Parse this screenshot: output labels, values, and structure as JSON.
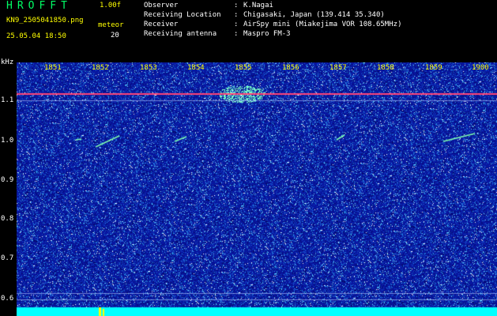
{
  "header": {
    "title": "HROFFT",
    "version": "1.00f",
    "filename": "KN9_2505041850.png",
    "meteor_label": "meteor",
    "datetime": "25.05.04 18:50",
    "meteor_count": "20"
  },
  "info": [
    {
      "label": "Observer",
      "sep": ":",
      "value": "K.Nagai"
    },
    {
      "label": "Receiving Location",
      "sep": ":",
      "value": "Chigasaki, Japan (139.414 35.340)"
    },
    {
      "label": "Receiver",
      "sep": ":",
      "value": "AirSpy mini (Miakejima VOR 108.65MHz)"
    },
    {
      "label": "Receiving antenna",
      "sep": ":",
      "value": "Maspro FM-3"
    }
  ],
  "axis": {
    "y_unit": "kHz",
    "y_ticks": [
      "1.1",
      "1.0",
      "0.9",
      "0.8",
      "0.7",
      "0.6"
    ],
    "y_values": [
      1.1,
      1.0,
      0.9,
      0.8,
      0.7,
      0.6
    ],
    "time_ticks": [
      "1851",
      "1852",
      "1853",
      "1854",
      "1855",
      "1856",
      "1857",
      "1858",
      "1859",
      "1900"
    ]
  },
  "colors": {
    "background": "#000000",
    "noise_low": "#0a1bb0",
    "noise_high": "#ffffff",
    "carrier": "#ff4477",
    "header_yellow": "#ffff00",
    "title_green": "#00ff66",
    "floor_cyan": "#00ffff"
  }
}
